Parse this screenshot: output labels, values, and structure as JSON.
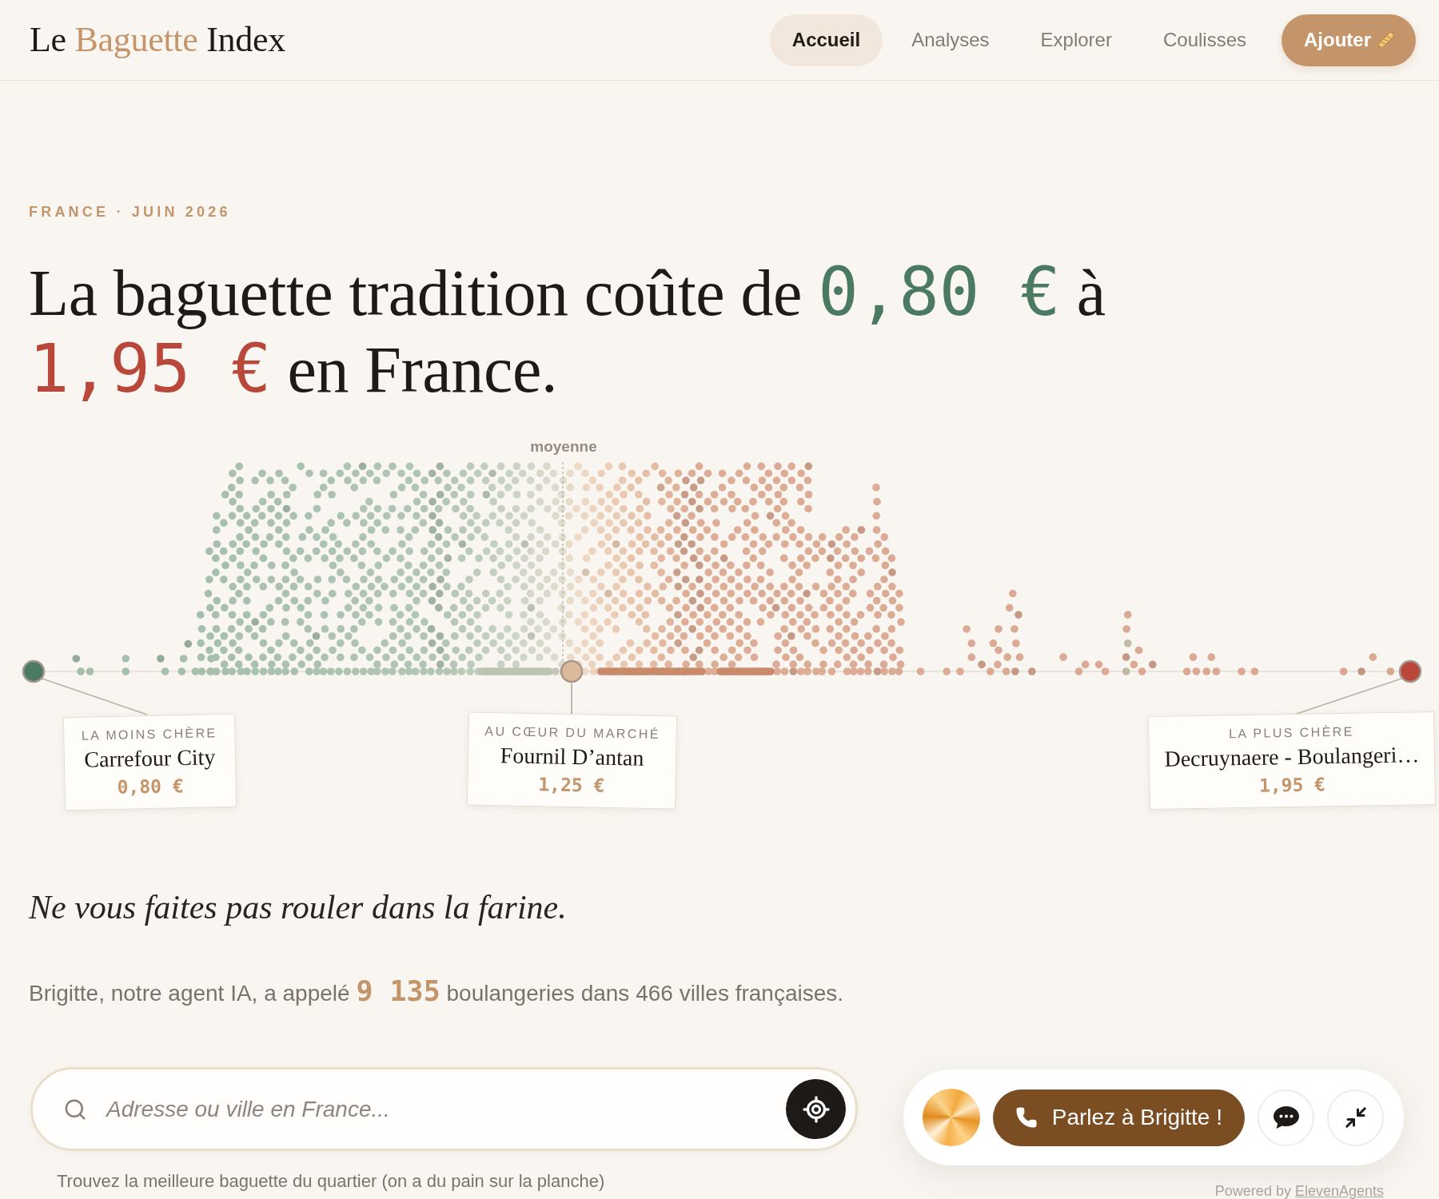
{
  "header": {
    "logo": {
      "before": "Le",
      "highlight": "Baguette",
      "after": "Index"
    },
    "nav": [
      {
        "label": "Accueil",
        "selected": true
      },
      {
        "label": "Analyses",
        "selected": false
      },
      {
        "label": "Explorer",
        "selected": false
      },
      {
        "label": "Coulisses",
        "selected": false
      }
    ],
    "cta": {
      "label": "Ajouter"
    }
  },
  "hero": {
    "eyebrow": "FRANCE · JUIN 2026",
    "headline": [
      {
        "kind": "text",
        "text": "La baguette tradition coûte de "
      },
      {
        "kind": "low",
        "text": "0,80 €"
      },
      {
        "kind": "text",
        "text": " à "
      },
      {
        "kind": "high",
        "text": "1,95 €"
      },
      {
        "kind": "text",
        "text": " en France."
      }
    ]
  },
  "chart": {
    "mean_label": "moyenne",
    "highlights": [
      {
        "label": "LA MOINS CHÈRE",
        "name": "Carrefour City",
        "price": "0,80 €",
        "color": "#4b7a62"
      },
      {
        "label": "AU CŒUR DU MARCHÉ",
        "name": "Fournil D’antan",
        "price": "1,25 €",
        "color": "#dcbb9c"
      },
      {
        "label": "LA PLUS CHÈRE",
        "name": "Decruynaere - Boulangeri…",
        "price": "1,95 €",
        "color": "#b9483a"
      }
    ]
  },
  "tagline": "Ne vous faites pas rouler dans la farine.",
  "stats": "Brigitte, notre agent IA, a appelé **9 135** boulangeries dans 466 villes françaises.",
  "search": {
    "placeholder": "Adresse ou ville en France...",
    "hint": "Trouvez la meilleure baguette du quartier (on a du pain sur la planche)"
  },
  "agent_widget": {
    "call_label": "Parlez à Brigitte !",
    "powered_by": "Powered by",
    "link": "ElevenAgents"
  }
}
